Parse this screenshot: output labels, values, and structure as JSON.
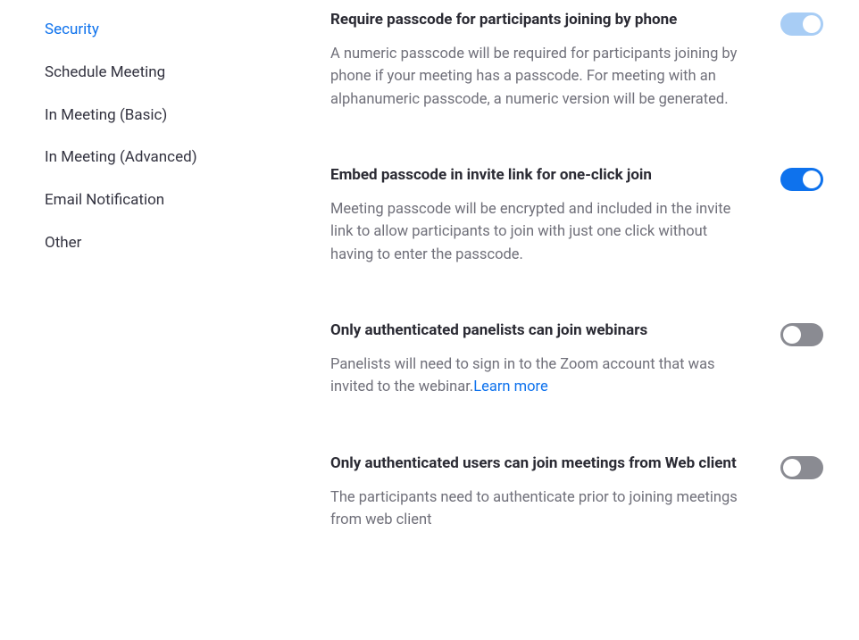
{
  "sidebar": {
    "items": [
      {
        "label": "Security",
        "active": true
      },
      {
        "label": "Schedule Meeting",
        "active": false
      },
      {
        "label": "In Meeting (Basic)",
        "active": false
      },
      {
        "label": "In Meeting (Advanced)",
        "active": false
      },
      {
        "label": "Email Notification",
        "active": false
      },
      {
        "label": "Other",
        "active": false
      }
    ]
  },
  "settings": [
    {
      "id": "require-phone-passcode",
      "title": "Require passcode for participants joining by phone",
      "description": "A numeric passcode will be required for participants joining by phone if your meeting has a passcode. For meeting with an alphanumeric passcode, a numeric version will be generated.",
      "toggle_state": "on-locked"
    },
    {
      "id": "embed-passcode",
      "title": "Embed passcode in invite link for one-click join",
      "description": "Meeting passcode will be encrypted and included in the invite link to allow participants to join with just one click without having to enter the passcode.",
      "toggle_state": "on"
    },
    {
      "id": "auth-panelists",
      "title": "Only authenticated panelists can join webinars",
      "description": "Panelists will need to sign in to the Zoom account that was invited to the webinar.",
      "learn_more": "Learn more",
      "toggle_state": "off"
    },
    {
      "id": "auth-web-client",
      "title": "Only authenticated users can join meetings from Web client",
      "description": "The participants need to authenticate prior to joining meetings from web client",
      "toggle_state": "off"
    }
  ]
}
